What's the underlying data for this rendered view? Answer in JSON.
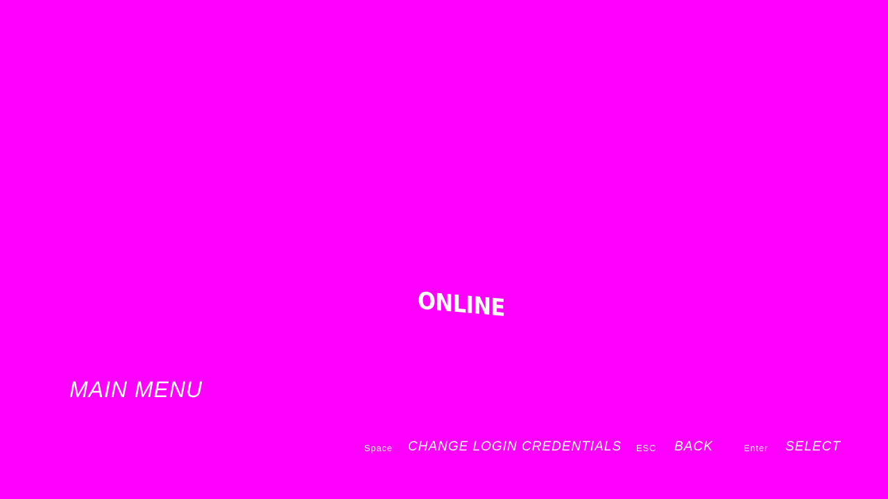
{
  "menu": {
    "items": [
      {
        "label": "ONLINE"
      }
    ]
  },
  "screen_title": "MAIN MENU",
  "hints": {
    "space_key": "Space",
    "space_action": "CHANGE LOGIN CREDENTIALS",
    "esc_key": "ESC",
    "esc_action": "BACK",
    "enter_key": "Enter",
    "enter_action": "SELECT"
  },
  "colors": {
    "background": "#ff00ff",
    "text": "#ffffff"
  }
}
